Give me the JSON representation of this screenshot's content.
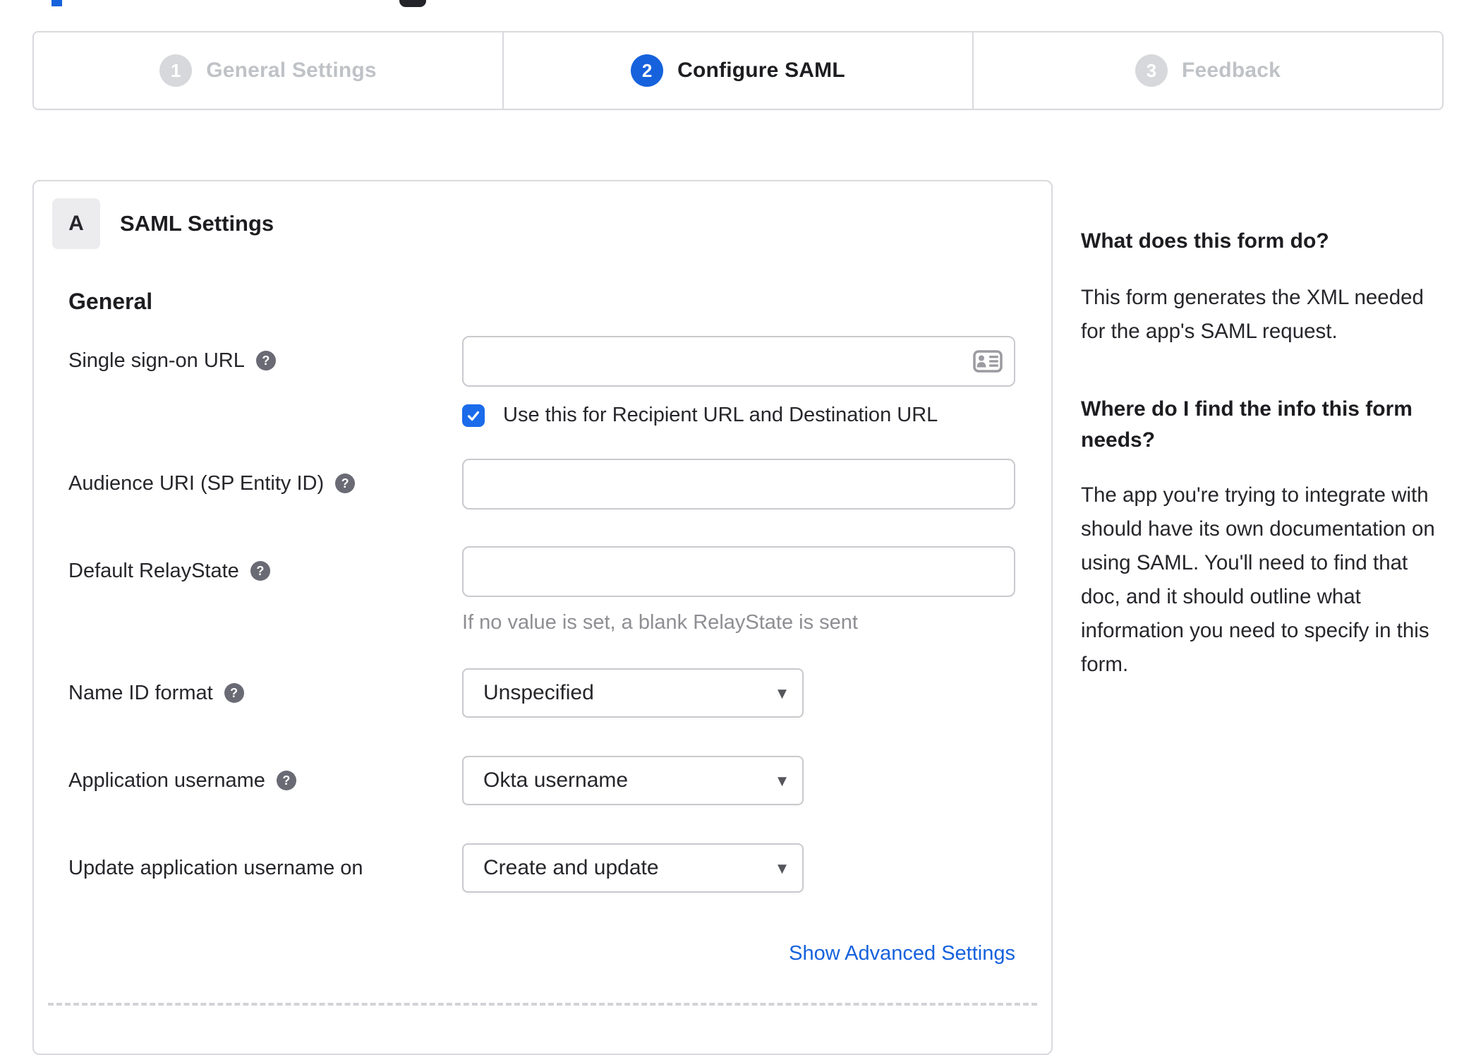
{
  "colors": {
    "accent_blue": "#1662dd",
    "checkbox_blue": "#1b6beb",
    "link_blue": "#1662dd",
    "inactive_gray": "#bfc2c6"
  },
  "icons": {
    "help_glyph": "?",
    "dropdown_glyph": "▾",
    "autofill": "contact-card",
    "checkbox_check": "checkmark"
  },
  "stepper": {
    "steps": [
      {
        "number": "1",
        "label": "General Settings",
        "state": "inactive"
      },
      {
        "number": "2",
        "label": "Configure SAML",
        "state": "active"
      },
      {
        "number": "3",
        "label": "Feedback",
        "state": "inactive"
      }
    ]
  },
  "panel": {
    "badge": "A",
    "title": "SAML Settings",
    "group_heading": "General"
  },
  "form": {
    "sso": {
      "label": "Single sign-on URL",
      "value": "",
      "checkbox_checked": true,
      "checkbox_label": "Use this for Recipient URL and Destination URL"
    },
    "audience": {
      "label": "Audience URI (SP Entity ID)",
      "value": ""
    },
    "relay": {
      "label": "Default RelayState",
      "value": "",
      "hint": "If no value is set, a blank RelayState is sent"
    },
    "name_id": {
      "label": "Name ID format",
      "value": "Unspecified"
    },
    "app_username": {
      "label": "Application username",
      "value": "Okta username"
    },
    "update_username": {
      "label": "Update application username on",
      "value": "Create and update"
    },
    "advanced_link": "Show Advanced Settings"
  },
  "sidebar": {
    "heading_1": "What does this form do?",
    "paragraph_1": "This form generates the XML needed for the app's SAML request.",
    "heading_2": "Where do I find the info this form needs?",
    "paragraph_2": "The app you're trying to integrate with should have its own documentation on using SAML. You'll need to find that doc, and it should outline what information you need to specify in this form."
  }
}
